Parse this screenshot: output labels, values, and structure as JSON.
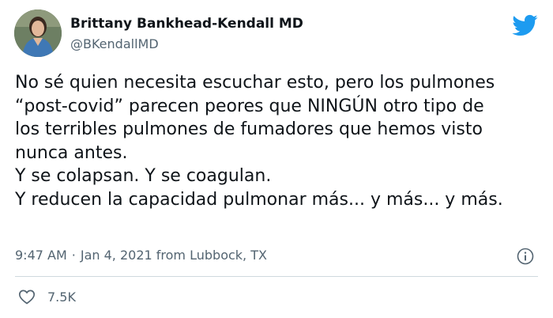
{
  "author": {
    "name": "Brittany Bankhead-Kendall MD",
    "handle": "@BKendallMD",
    "avatar_icon": "profile-photo"
  },
  "brand": {
    "icon": "twitter-bird-icon",
    "color": "#1d9bf0"
  },
  "tweet": {
    "lines": [
      "No sé quien necesita escuchar esto, pero los pulmones",
      "“post-covid” parecen peores que NINGÚN otro tipo de",
      "los terribles pulmones de fumadores que hemos visto",
      "nunca antes.",
      "Y se colapsan. Y se coagulan.",
      "Y reducen la capacidad pulmonar más... y más... y más."
    ]
  },
  "meta": {
    "time": "9:47 AM",
    "separator": "·",
    "date": "Jan 4, 2021",
    "source": "from Lubbock, TX",
    "info_icon": "info-icon"
  },
  "engagement": {
    "like_icon": "heart-icon",
    "like_count": "7.5K"
  },
  "colors": {
    "text": "#0f1419",
    "secondary": "#536471",
    "divider": "#cfd9de"
  }
}
